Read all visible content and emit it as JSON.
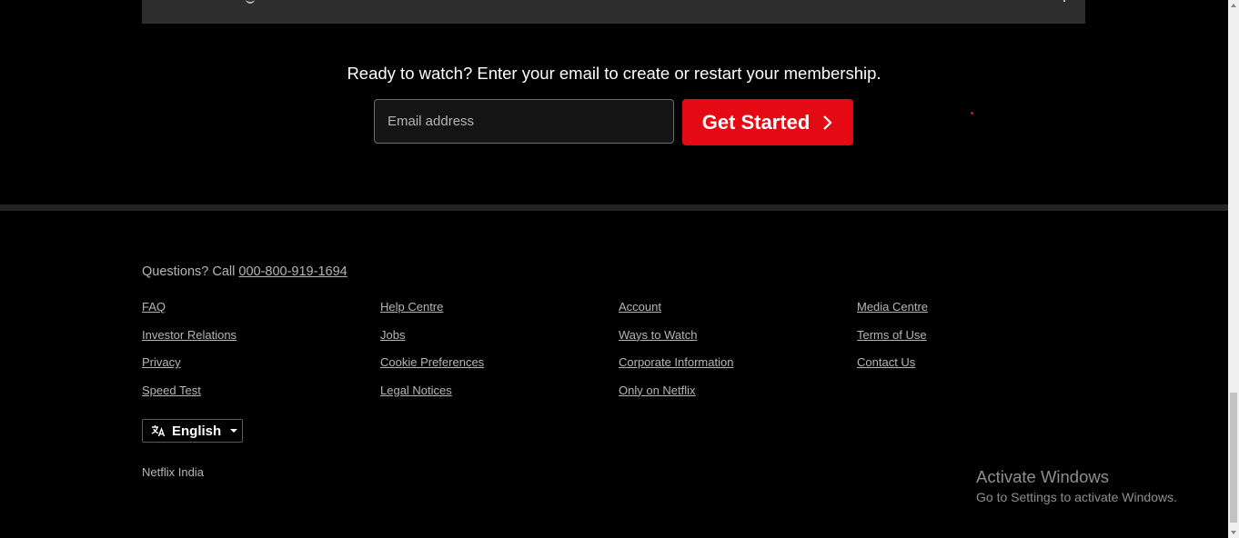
{
  "cta": {
    "text": "Ready to watch? Enter your email to create or restart your membership.",
    "email_placeholder": "Email address",
    "button_label": "Get Started"
  },
  "footer": {
    "questions_prefix": "Questions? Call ",
    "phone": "000-800-919-1694",
    "columns": [
      [
        "FAQ",
        "Investor Relations",
        "Privacy",
        "Speed Test"
      ],
      [
        "Help Centre",
        "Jobs",
        "Cookie Preferences",
        "Legal Notices"
      ],
      [
        "Account",
        "Ways to Watch",
        "Corporate Information",
        "Only on Netflix"
      ],
      [
        "Media Centre",
        "Terms of Use",
        "Contact Us"
      ]
    ],
    "language": "English",
    "country": "Netflix India"
  },
  "overlay": {
    "activate_title": "Activate Windows",
    "activate_subtitle": "Go to Settings to activate Windows."
  },
  "colors": {
    "brand_red": "#e50914",
    "background": "#000000"
  }
}
